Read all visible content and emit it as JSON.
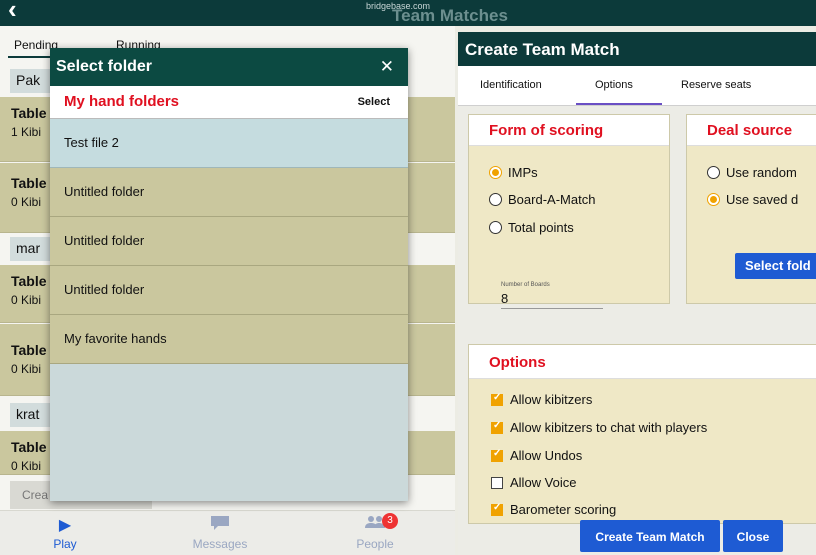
{
  "statusbar": {
    "url": "bridgebase.com",
    "ghost_title": "Team Matches",
    "back_icon": "chevron-left-icon"
  },
  "left_panel": {
    "tabs": [
      "Pending",
      "Running"
    ],
    "chips": [
      "Pak",
      "mar",
      "krat"
    ],
    "rows": [
      {
        "title": "Table",
        "sub": "1 Kibi"
      },
      {
        "title": "Table",
        "sub": "0 Kibi"
      },
      {
        "title": "Table",
        "sub": "0 Kibi"
      },
      {
        "title": "Table",
        "sub": "0 Kibi"
      },
      {
        "title": "Table",
        "sub": "0 Kibi"
      }
    ],
    "create_label": "Crea"
  },
  "bottom_nav": {
    "play": "Play",
    "messages": "Messages",
    "people": "People",
    "people_badge": "3"
  },
  "dialog": {
    "title": "Select folder",
    "close_icon": "close-icon",
    "header_title": "My hand folders",
    "select_label": "Select",
    "folders": [
      "Test file 2",
      "Untitled folder",
      "Untitled folder",
      "Untitled folder",
      "My favorite hands"
    ],
    "active_index": 0
  },
  "create_team_match": {
    "title": "Create Team Match",
    "tabs": [
      "Identification",
      "Options",
      "Reserve seats"
    ],
    "active_tab": "Options",
    "scoring": {
      "title": "Form of scoring",
      "options": [
        "IMPs",
        "Board-A-Match",
        "Total points"
      ],
      "selected": "IMPs",
      "boards_label": "Number of Boards",
      "boards_value": "8"
    },
    "deal_source": {
      "title": "Deal source",
      "options": [
        "Use random",
        "Use saved d"
      ],
      "selected": "Use saved d",
      "button_label": "Select fold"
    },
    "options": {
      "title": "Options",
      "items": [
        {
          "label": "Allow kibitzers",
          "checked": true
        },
        {
          "label": "Allow kibitzers to chat with players",
          "checked": true
        },
        {
          "label": "Allow Undos",
          "checked": true
        },
        {
          "label": "Allow Voice",
          "checked": false
        },
        {
          "label": "Barometer scoring",
          "checked": true
        }
      ]
    },
    "create_button": "Create Team Match",
    "close_button": "Close"
  },
  "colors": {
    "dark_teal": "#0c3a3a",
    "accent_red": "#e01020",
    "accent_blue": "#1e5bd3",
    "accent_orange": "#f0a200"
  }
}
